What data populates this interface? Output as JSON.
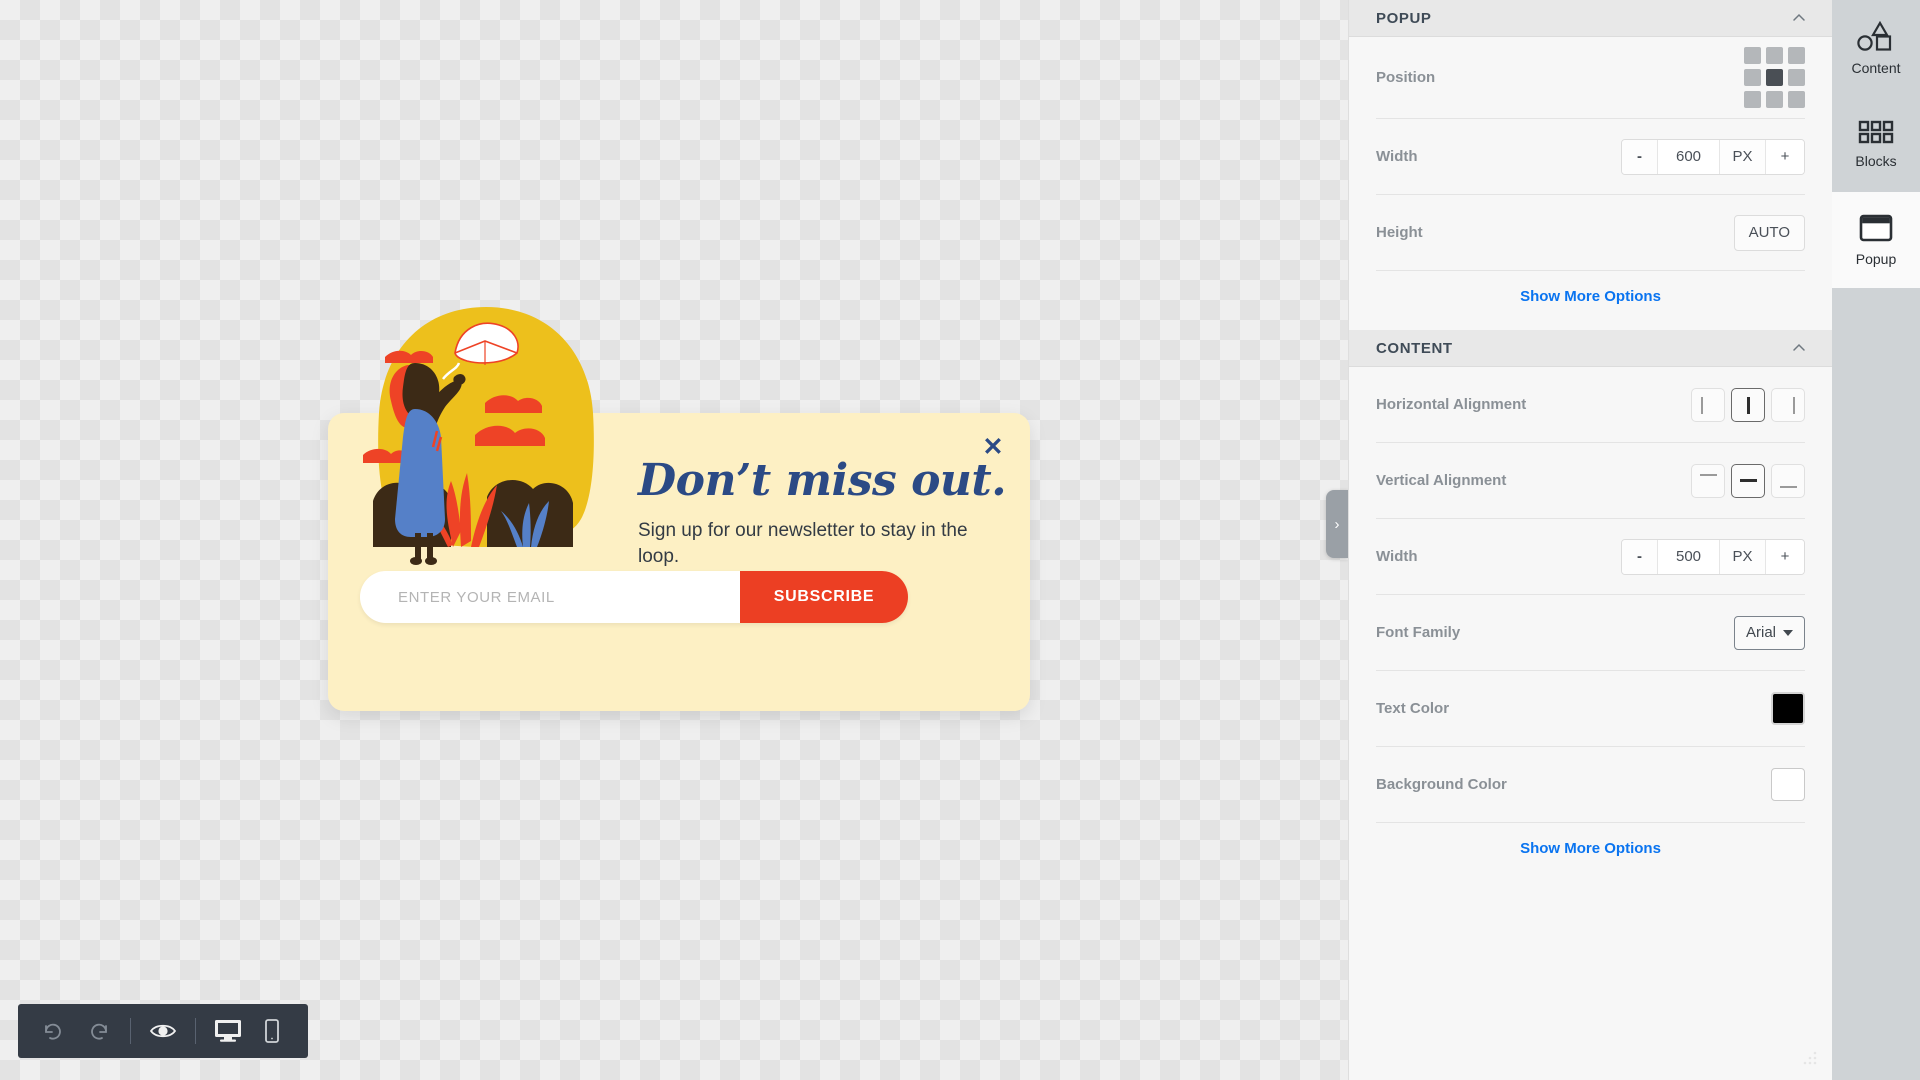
{
  "canvas": {
    "popup": {
      "heading": "Don’t miss out.",
      "subheading": "Sign up for our newsletter to stay in the loop.",
      "email_placeholder": "ENTER YOUR EMAIL",
      "email_value": "",
      "subscribe_label": "SUBSCRIBE",
      "close_label": "✕",
      "background_color": "#fdf0c4",
      "heading_color": "#2b4a85",
      "button_color": "#ec3f23"
    },
    "collapse_tab": {
      "glyph": "›"
    },
    "toolbar": {
      "undo": "undo-icon",
      "redo": "redo-icon",
      "preview": "eye-icon",
      "desktop": "desktop-icon",
      "mobile": "mobile-icon"
    }
  },
  "panel": {
    "sections": [
      {
        "title": "POPUP",
        "collapse_glyph": "chevron-up-icon",
        "rows": [
          {
            "label": "Position",
            "control": "position-grid",
            "selected_cell": 4
          },
          {
            "label": "Width",
            "control": "stepper",
            "minus": "-",
            "value": "600",
            "unit": "PX",
            "plus": "+"
          },
          {
            "label": "Height",
            "control": "button",
            "value": "AUTO"
          }
        ],
        "more_options": "Show More Options"
      },
      {
        "title": "CONTENT",
        "collapse_glyph": "chevron-up-icon",
        "rows": [
          {
            "label": "Horizontal Alignment",
            "control": "align-h",
            "options": [
              "left",
              "center",
              "right"
            ],
            "selected": "center"
          },
          {
            "label": "Vertical Alignment",
            "control": "align-v",
            "options": [
              "top",
              "middle",
              "bottom"
            ],
            "selected": "middle"
          },
          {
            "label": "Width",
            "control": "stepper",
            "minus": "-",
            "value": "500",
            "unit": "PX",
            "plus": "+"
          },
          {
            "label": "Font Family",
            "control": "select",
            "value": "Arial"
          },
          {
            "label": "Text Color",
            "control": "swatch",
            "value": "#000000"
          },
          {
            "label": "Background Color",
            "control": "swatch",
            "value": "#ffffff"
          }
        ],
        "more_options": "Show More Options"
      }
    ]
  },
  "rail": {
    "items": [
      {
        "label": "Content",
        "icon": "shapes-icon",
        "active": false
      },
      {
        "label": "Blocks",
        "icon": "grid-icon",
        "active": false
      },
      {
        "label": "Popup",
        "icon": "window-icon",
        "active": true
      }
    ]
  }
}
